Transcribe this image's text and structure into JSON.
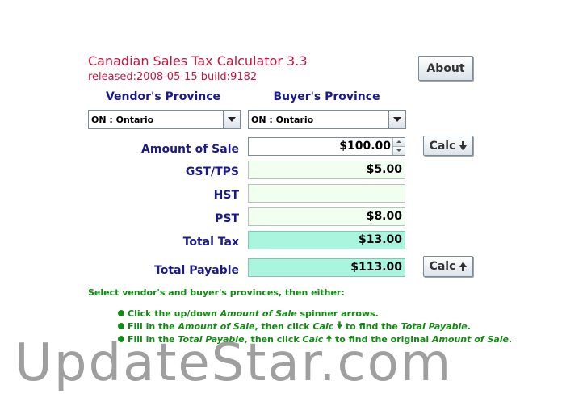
{
  "app": {
    "title": "Canadian Sales Tax Calculator 3.3",
    "release": "released:2008-05-15 build:9182"
  },
  "buttons": {
    "about": "About",
    "calc_down": "Calc",
    "calc_up": "Calc"
  },
  "provinces": {
    "vendor_label": "Vendor's Province",
    "buyer_label": "Buyer's Province",
    "vendor_value": "ON : Ontario",
    "buyer_value": "ON : Ontario"
  },
  "rows": {
    "amount_label": "Amount of Sale",
    "amount_value": "$100.00",
    "gst_label": "GST/TPS",
    "gst_value": "$5.00",
    "hst_label": "HST",
    "hst_value": "",
    "pst_label": "PST",
    "pst_value": "$8.00",
    "total_tax_label": "Total Tax",
    "total_tax_value": "$13.00",
    "total_payable_label": "Total Payable",
    "total_payable_value": "$113.00"
  },
  "instructions": {
    "intro": "Select vendor's and buyer's provinces, then either:",
    "b1_a": "Click the up/down ",
    "b1_b": "Amount of Sale",
    "b1_c": " spinner arrows.",
    "b2_a": "Fill in the ",
    "b2_b": "Amount of Sale",
    "b2_c": ", then click ",
    "b2_d": "Calc",
    "b2_e": " to find the ",
    "b2_f": "Total Payable",
    "b2_g": ".",
    "b3_a": "Fill in the ",
    "b3_b": "Total Payable",
    "b3_c": ", then click ",
    "b3_d": "Calc",
    "b3_e": " to find the original ",
    "b3_f": "Amount of Sale",
    "b3_g": "."
  },
  "watermark": "UpdateStar.com",
  "icons": {
    "calc_down": "arrow-down-icon",
    "calc_up": "arrow-up-icon",
    "bullet": "bullet-dot-icon"
  },
  "colors": {
    "title": "#c8143c",
    "label": "#1a1a8c",
    "instructions": "#138a13",
    "field_bg": "#f0fff0",
    "total_bg": "#aaf5dd"
  }
}
